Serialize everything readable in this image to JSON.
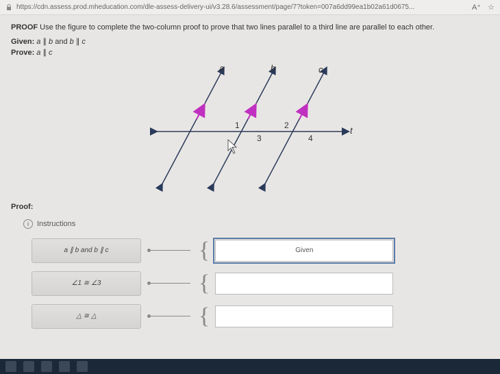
{
  "url": "https://cdn.assess.prod.mheducation.com/dle-assess-delivery-ui/v3.28.6/assessment/page/7?token=007a6dd99ea1b02a61d0675...",
  "header": {
    "proof_label": "PROOF",
    "proof_text": " Use the figure to complete the two-column proof to prove that two lines parallel to a third line are parallel to each other.",
    "given_label": "Given: ",
    "given_text_a": "a",
    "given_text_sep1": " ∥ ",
    "given_text_b": "b",
    "given_text_and": " and ",
    "given_text_b2": "b",
    "given_text_sep2": " ∥ ",
    "given_text_c": "c",
    "prove_label": "Prove: ",
    "prove_a": "a",
    "prove_sep": " ∥ ",
    "prove_c": "c"
  },
  "figure": {
    "labels": {
      "a": "a",
      "b": "b",
      "c": "c",
      "t": "t",
      "n1": "1",
      "n2": "2",
      "n3": "3",
      "n4": "4"
    }
  },
  "proof_section_label": "Proof:",
  "instructions_label": "Instructions",
  "instructions_icon": "i",
  "rows": [
    {
      "statement": "a ∥ b and b ∥ c",
      "reason": "Given",
      "selected": true
    },
    {
      "statement": "∠1 ≅ ∠3",
      "reason": "",
      "selected": false
    },
    {
      "statement": "△ ≅ △",
      "reason": "",
      "selected": false
    }
  ]
}
